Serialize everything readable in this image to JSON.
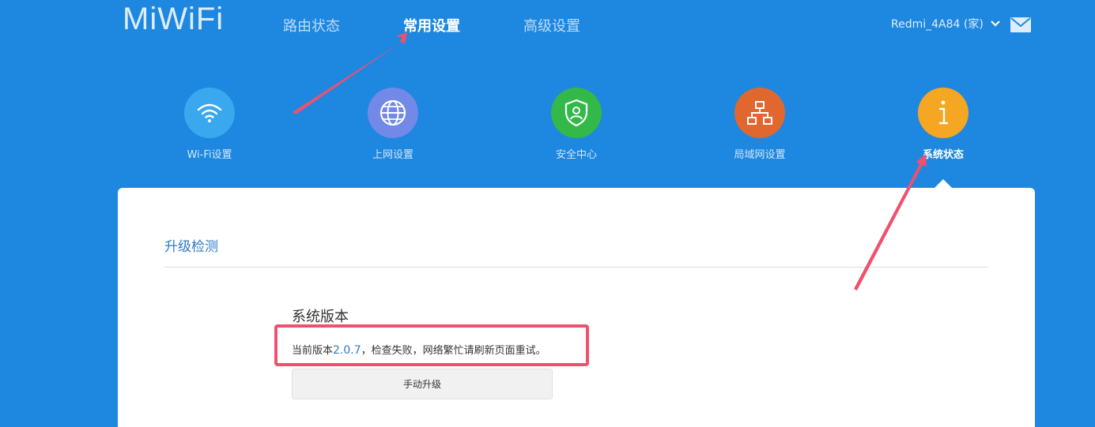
{
  "header": {
    "logo": "MiWiFi",
    "nav": [
      {
        "label": "路由状态",
        "active": false
      },
      {
        "label": "常用设置",
        "active": true
      },
      {
        "label": "高级设置",
        "active": false
      }
    ],
    "user": "Redmi_4A84 (家)"
  },
  "icons": [
    {
      "label": "Wi-Fi设置",
      "color": "#3aa8ef",
      "icon": "wifi-icon"
    },
    {
      "label": "上网设置",
      "color": "#7289e8",
      "icon": "globe-icon"
    },
    {
      "label": "安全中心",
      "color": "#33b84a",
      "icon": "shield-icon"
    },
    {
      "label": "局域网设置",
      "color": "#e0682f",
      "icon": "network-icon"
    },
    {
      "label": "系统状态",
      "color": "#f5a623",
      "icon": "info-icon",
      "active": true
    }
  ],
  "main": {
    "section_title": "升级检测",
    "sys_heading": "系统版本",
    "version_prefix": "当前版本",
    "version": "2.0.7",
    "version_suffix": "，检查失败，网络繁忙请刷新页面重试。",
    "upgrade_button": "手动升级"
  },
  "colors": {
    "background": "#1e87e0",
    "annotation": "#f0506e",
    "link": "#2f7bc9"
  }
}
